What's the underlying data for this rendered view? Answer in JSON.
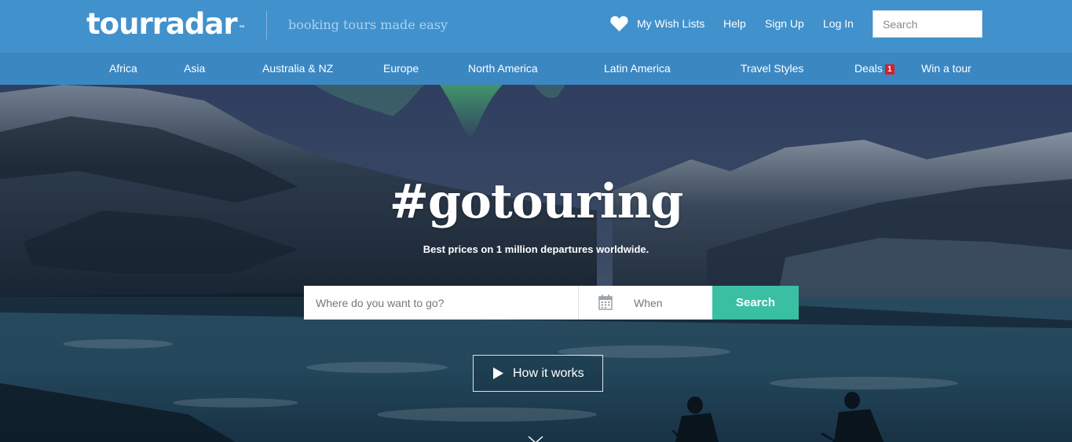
{
  "header": {
    "logo_text": "tourradar",
    "logo_tm": "™",
    "tagline": "booking tours made easy",
    "links": {
      "wishlists": "My Wish Lists",
      "help": "Help",
      "signup": "Sign Up",
      "login": "Log In"
    },
    "search_placeholder": "Search"
  },
  "nav": {
    "items": [
      "Africa",
      "Asia",
      "Australia & NZ",
      "Europe",
      "North America",
      "Latin America",
      "Travel Styles",
      "Deals",
      "Win a tour"
    ],
    "deals_badge": "1"
  },
  "hero": {
    "title": "#gotouring",
    "subtitle": "Best prices on 1 million departures worldwide.",
    "where_placeholder": "Where do you want to go?",
    "when_placeholder": "When",
    "search_label": "Search",
    "how_label": "How it works"
  },
  "icons": {
    "wishlist": "heart-icon",
    "date": "calendar-icon",
    "video": "play-icon",
    "scroll": "chevron-down-icon"
  },
  "colors": {
    "header_bg": "#4191cd",
    "nav_bg": "#3b87c2",
    "search_button": "#3bbfa3",
    "deals_badge": "#d0212b",
    "tagline": "#a9d3f2"
  }
}
